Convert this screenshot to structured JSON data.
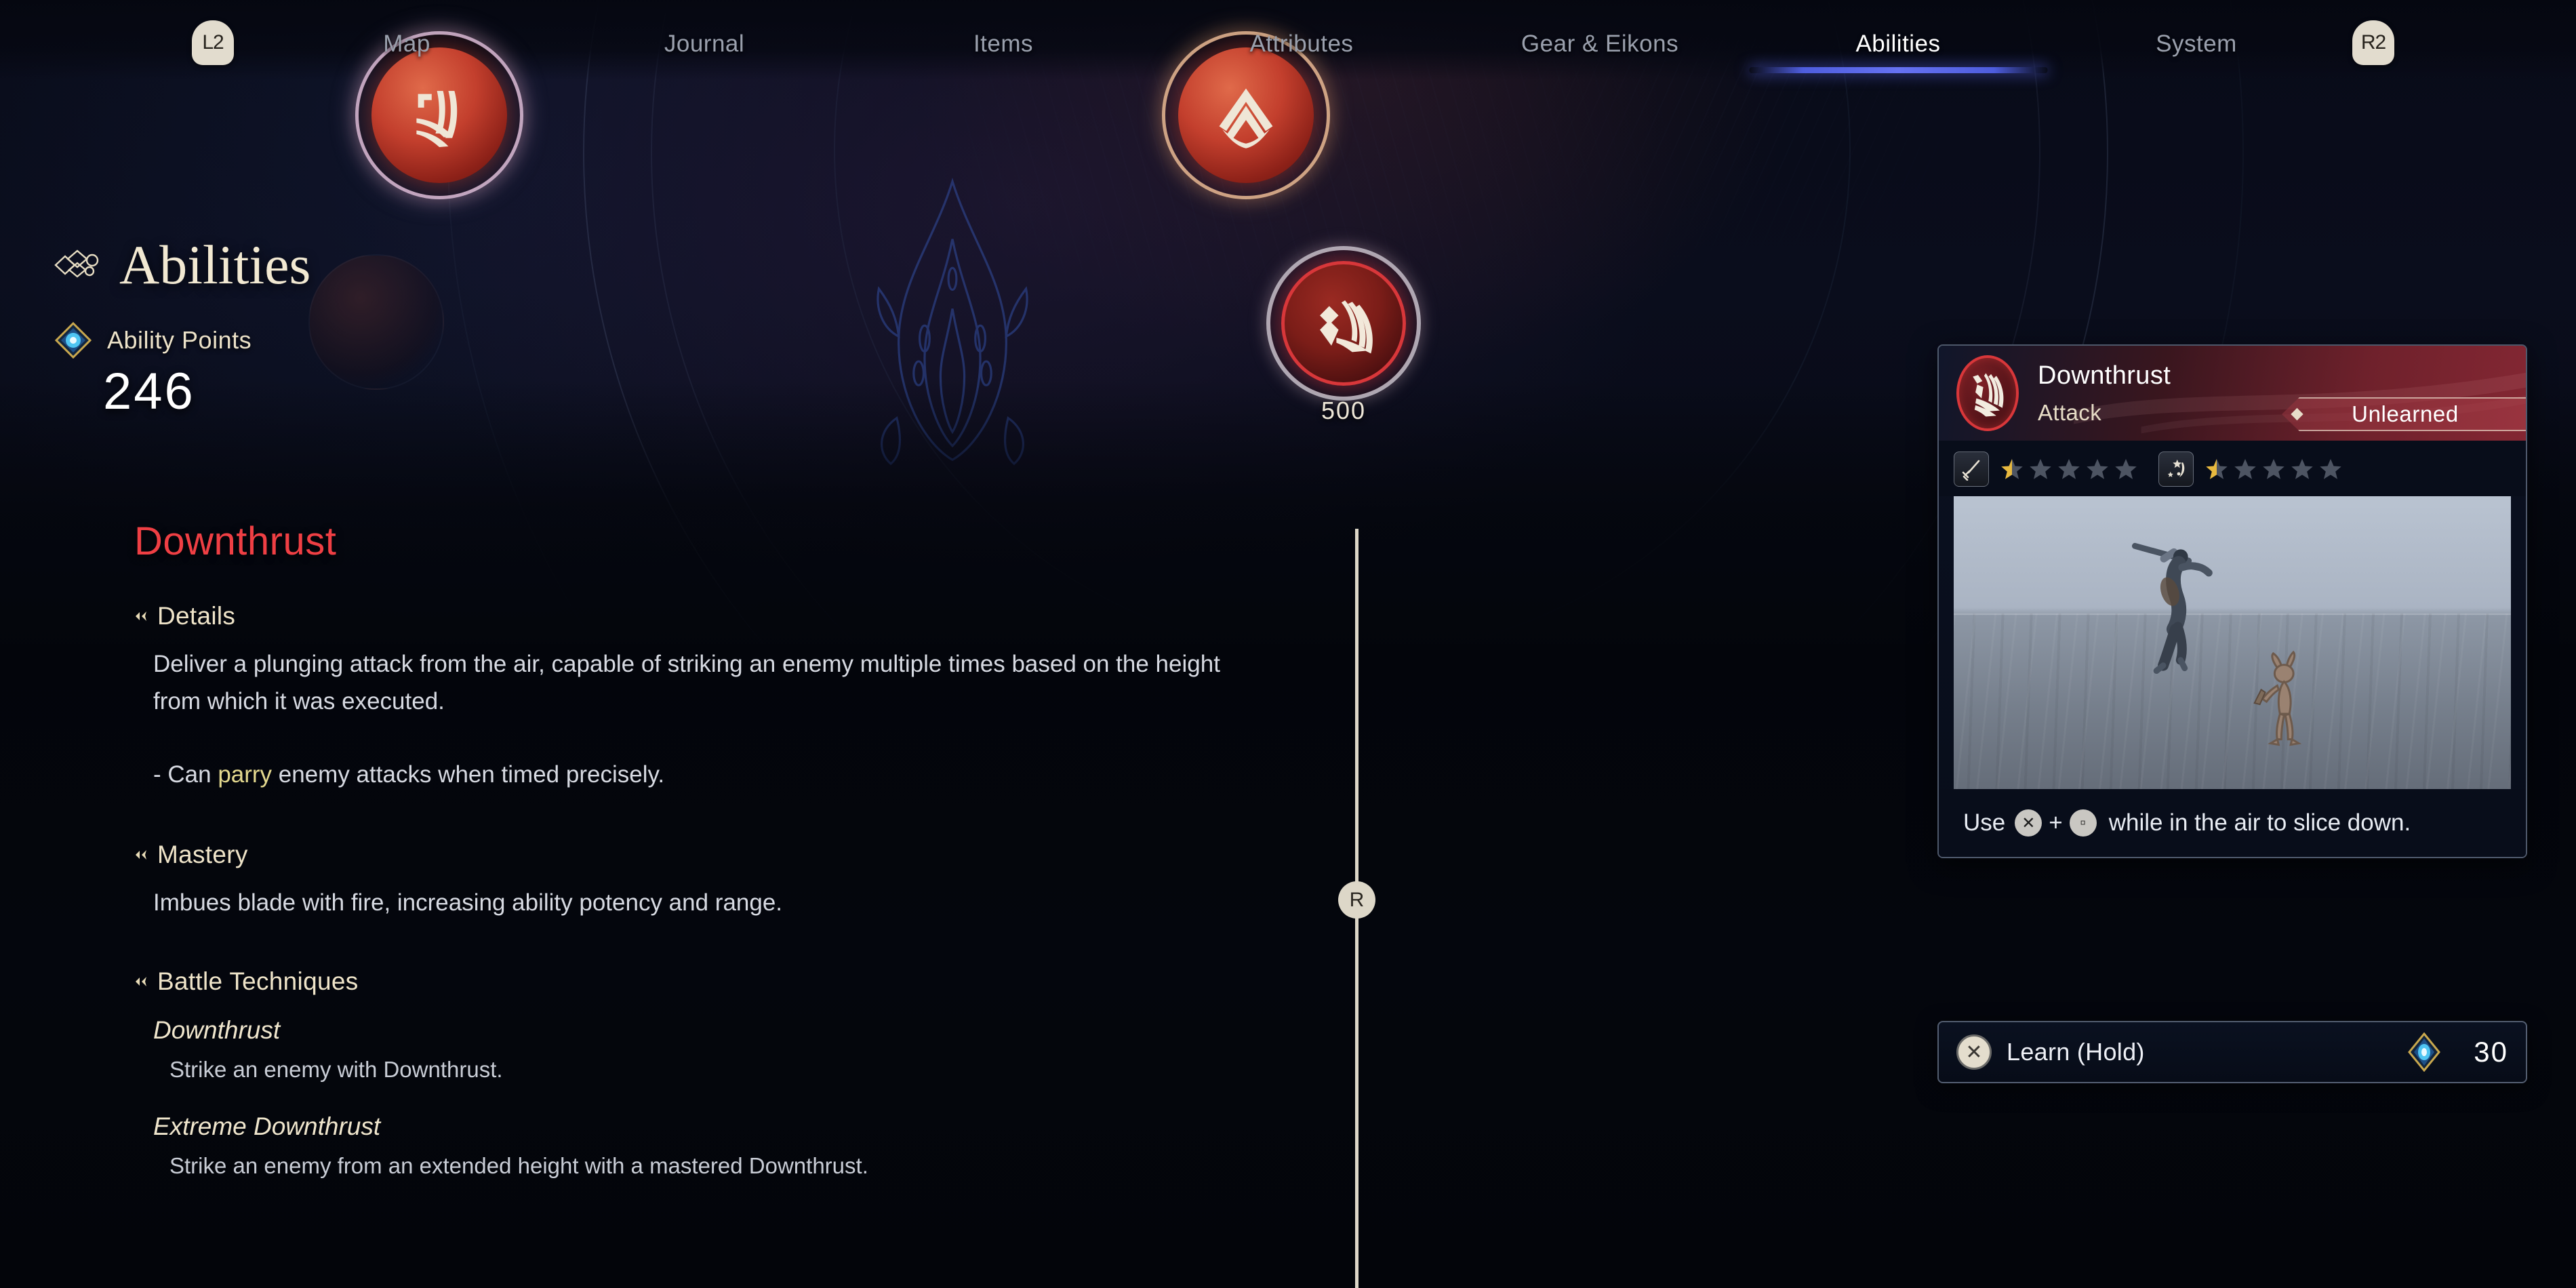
{
  "nav": {
    "left_shoulder": "L2",
    "right_shoulder": "R2",
    "tabs": [
      {
        "label": "Map",
        "active": false
      },
      {
        "label": "Journal",
        "active": false
      },
      {
        "label": "Items",
        "active": false
      },
      {
        "label": "Attributes",
        "active": false
      },
      {
        "label": "Gear & Eikons",
        "active": false
      },
      {
        "label": "Abilities",
        "active": true
      },
      {
        "label": "System",
        "active": false
      }
    ]
  },
  "header": {
    "title": "Abilities",
    "ability_points_label": "Ability Points",
    "ability_points_value": "246"
  },
  "skill_tree": {
    "nodes": [
      {
        "id": "node-left",
        "cost": "",
        "state": "learned"
      },
      {
        "id": "node-mid",
        "cost": "",
        "state": "learned"
      },
      {
        "id": "node-selected",
        "cost": "500",
        "state": "selected"
      },
      {
        "id": "node-dim",
        "cost": "",
        "state": "locked"
      }
    ]
  },
  "detail": {
    "ability_name": "Downthrust",
    "sections": [
      {
        "heading": "Details"
      },
      {
        "heading": "Mastery"
      },
      {
        "heading": "Battle Techniques"
      }
    ],
    "details_text": "Deliver a plunging attack from the air, capable of striking an enemy multiple times based on the height from which it was executed.",
    "details_bullet_prefix": "- Can ",
    "details_bullet_keyword": "parry",
    "details_bullet_suffix": " enemy attacks when timed precisely.",
    "mastery_text": "Imbues blade with fire, increasing ability potency and range.",
    "techniques": [
      {
        "name": "Downthrust",
        "desc": "Strike an enemy with Downthrust."
      },
      {
        "name": "Extreme Downthrust",
        "desc": "Strike an enemy from an extended height with a mastered Downthrust."
      }
    ]
  },
  "scroll": {
    "knob_label": "R"
  },
  "panel": {
    "ability_name": "Downthrust",
    "ability_type": "Attack",
    "status": "Unlearned",
    "stats": [
      {
        "icon": "sword-icon",
        "filled": 0.5,
        "max": 5
      },
      {
        "icon": "stagger-icon",
        "filled": 0.5,
        "max": 5
      }
    ],
    "use_hint": {
      "prefix": "Use",
      "button_a": "cross-button",
      "plus": "+",
      "button_b": "square-button",
      "suffix": "while in the air to slice down."
    }
  },
  "learn_bar": {
    "button": "cross-button",
    "label": "Learn (Hold)",
    "cost_icon": "ability-point-gem-icon",
    "cost": "30"
  },
  "colors": {
    "accent_red": "#ef3f44",
    "accent_gold": "#efe4c9",
    "tab_underline": "#5f6eff",
    "panel_border": "#afbed7",
    "star_gold": "#e8b93f",
    "gem_blue": "#3fc6f5"
  }
}
